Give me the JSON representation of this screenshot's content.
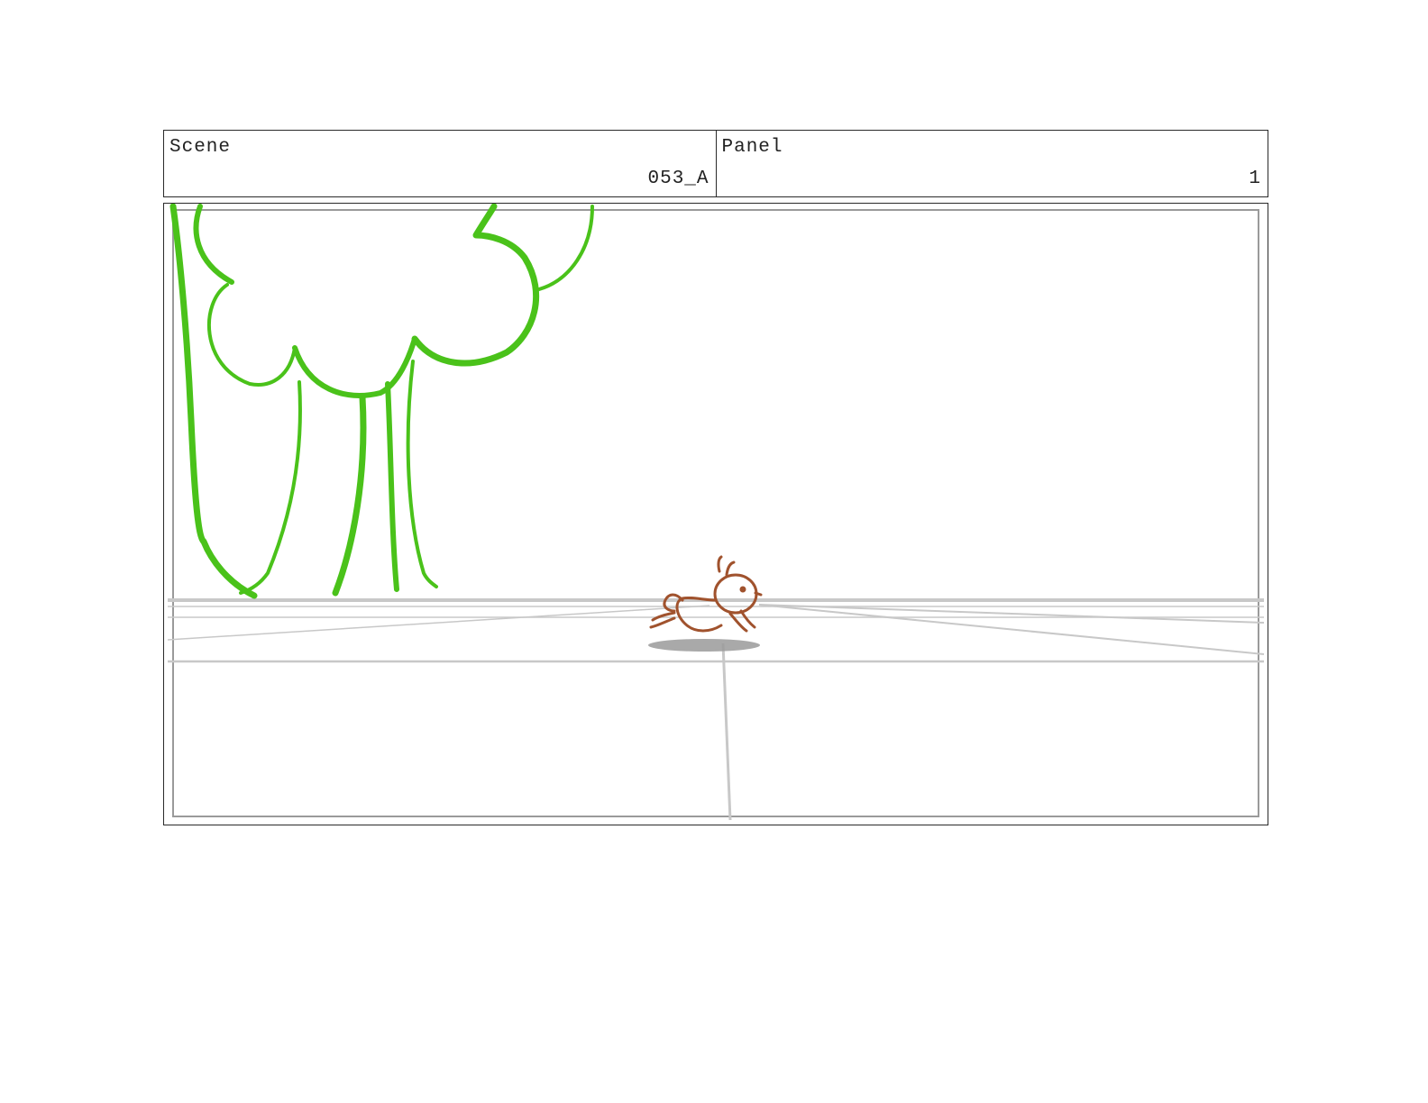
{
  "header": {
    "scene_label": "Scene",
    "scene_value": "053_A",
    "panel_label": "Panel",
    "panel_value": "1"
  },
  "colors": {
    "tree_green": "#4ac21a",
    "character_brown": "#a0522d",
    "guide_gray": "#c8c8c8",
    "shadow_gray": "#9a9a9a"
  }
}
